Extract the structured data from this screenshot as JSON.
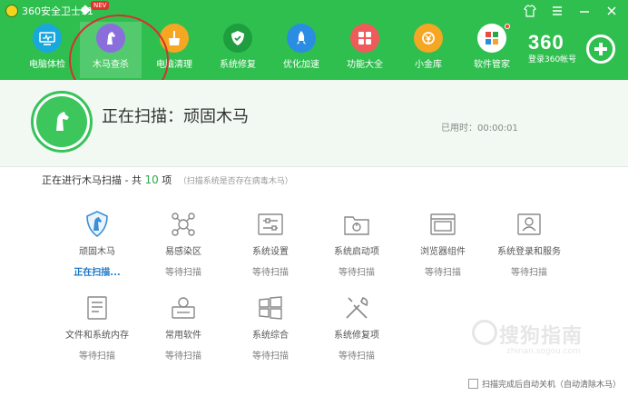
{
  "titlebar": {
    "app_title": "360安全卫士11",
    "new_badge": "NEV"
  },
  "nav": {
    "items": [
      {
        "label": "电脑体检",
        "icon": "monitor-check-icon",
        "color": "#18a8de"
      },
      {
        "label": "木马查杀",
        "icon": "horse-icon",
        "color": "#8a6fdc"
      },
      {
        "label": "电脑清理",
        "icon": "broom-icon",
        "color": "#f5a623"
      },
      {
        "label": "系统修复",
        "icon": "shield-check-icon",
        "color": "#27a845"
      },
      {
        "label": "优化加速",
        "icon": "rocket-icon",
        "color": "#2b8de2"
      },
      {
        "label": "功能大全",
        "icon": "grid-apps-icon",
        "color": "#ef5a5a"
      },
      {
        "label": "小金库",
        "icon": "coin-icon",
        "color": "#f5a623"
      },
      {
        "label": "软件管家",
        "icon": "software-icon",
        "color": "#ffffff"
      }
    ],
    "active_index": 1
  },
  "brand": {
    "logo_text": "360",
    "login_label": "登录360帐号"
  },
  "scan": {
    "title": "正在扫描：顽固木马",
    "elapsed": "已用时：00:00:01"
  },
  "progress": {
    "prefix": "正在进行木马扫描 - 共",
    "count": "10",
    "suffix": "项",
    "hint": "（扫描系统是否存在病毒木马）"
  },
  "items": [
    {
      "label": "顽固木马",
      "status": "正在扫描...",
      "icon": "shield-horse-icon",
      "scanning": true
    },
    {
      "label": "易感染区",
      "status": "等待扫描",
      "icon": "virus-icon",
      "scanning": false
    },
    {
      "label": "系统设置",
      "status": "等待扫描",
      "icon": "sliders-icon",
      "scanning": false
    },
    {
      "label": "系统启动项",
      "status": "等待扫描",
      "icon": "folder-power-icon",
      "scanning": false
    },
    {
      "label": "浏览器组件",
      "status": "等待扫描",
      "icon": "browser-window-icon",
      "scanning": false
    },
    {
      "label": "系统登录和服务",
      "status": "等待扫描",
      "icon": "user-card-icon",
      "scanning": false
    },
    {
      "label": "文件和系统内存",
      "status": "等待扫描",
      "icon": "document-icon",
      "scanning": false
    },
    {
      "label": "常用软件",
      "status": "等待扫描",
      "icon": "software-box-icon",
      "scanning": false
    },
    {
      "label": "系统综合",
      "status": "等待扫描",
      "icon": "windows-logo-icon",
      "scanning": false
    },
    {
      "label": "系统修复项",
      "status": "等待扫描",
      "icon": "tools-icon",
      "scanning": false
    }
  ],
  "footer": {
    "auto_shutdown_label": "扫描完成后自动关机（自动清除木马）",
    "auto_shutdown_checked": false
  },
  "watermark": {
    "text": "搜狗指南",
    "sub": "zhinan.sogou.com"
  },
  "colors": {
    "primary_green": "#2fbf4f",
    "scanning_blue": "#1e78c8",
    "annotation_red": "#d72f2f"
  }
}
